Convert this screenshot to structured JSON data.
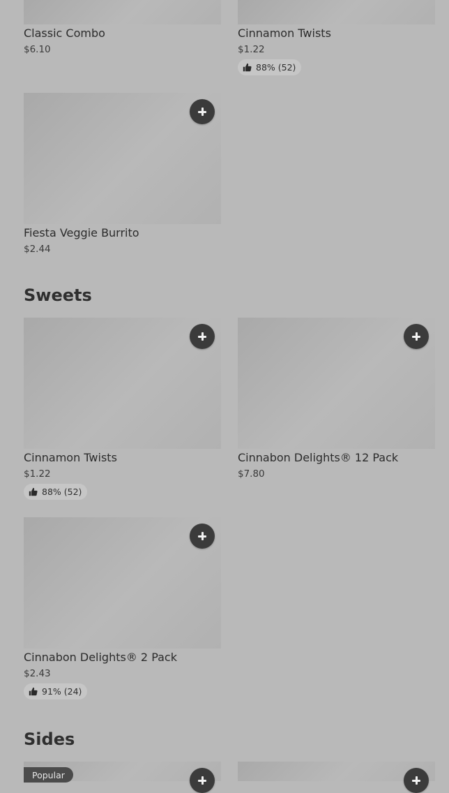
{
  "top_items": [
    {
      "name": "Classic Combo",
      "price": "$6.10"
    },
    {
      "name": "Cinnamon Twists",
      "price": "$1.22",
      "rating": "88% (52)"
    }
  ],
  "burrito": {
    "name": "Fiesta Veggie Burrito",
    "price": "$2.44"
  },
  "sweets": {
    "heading": "Sweets",
    "items": [
      {
        "name": "Cinnamon Twists",
        "price": "$1.22",
        "rating": "88% (52)"
      },
      {
        "name": "Cinnabon Delights® 12 Pack",
        "price": "$7.80"
      },
      {
        "name": "Cinnabon Delights® 2 Pack",
        "price": "$2.43",
        "rating": "91% (24)"
      }
    ]
  },
  "sides": {
    "heading": "Sides",
    "badge": "Popular"
  },
  "icons": {
    "add": "plus-icon",
    "rating": "thumbs-up-icon"
  },
  "colors": {
    "background": "#b9b9b9",
    "add_button": "#3b3b3b",
    "badge": "#4b4b4b"
  }
}
